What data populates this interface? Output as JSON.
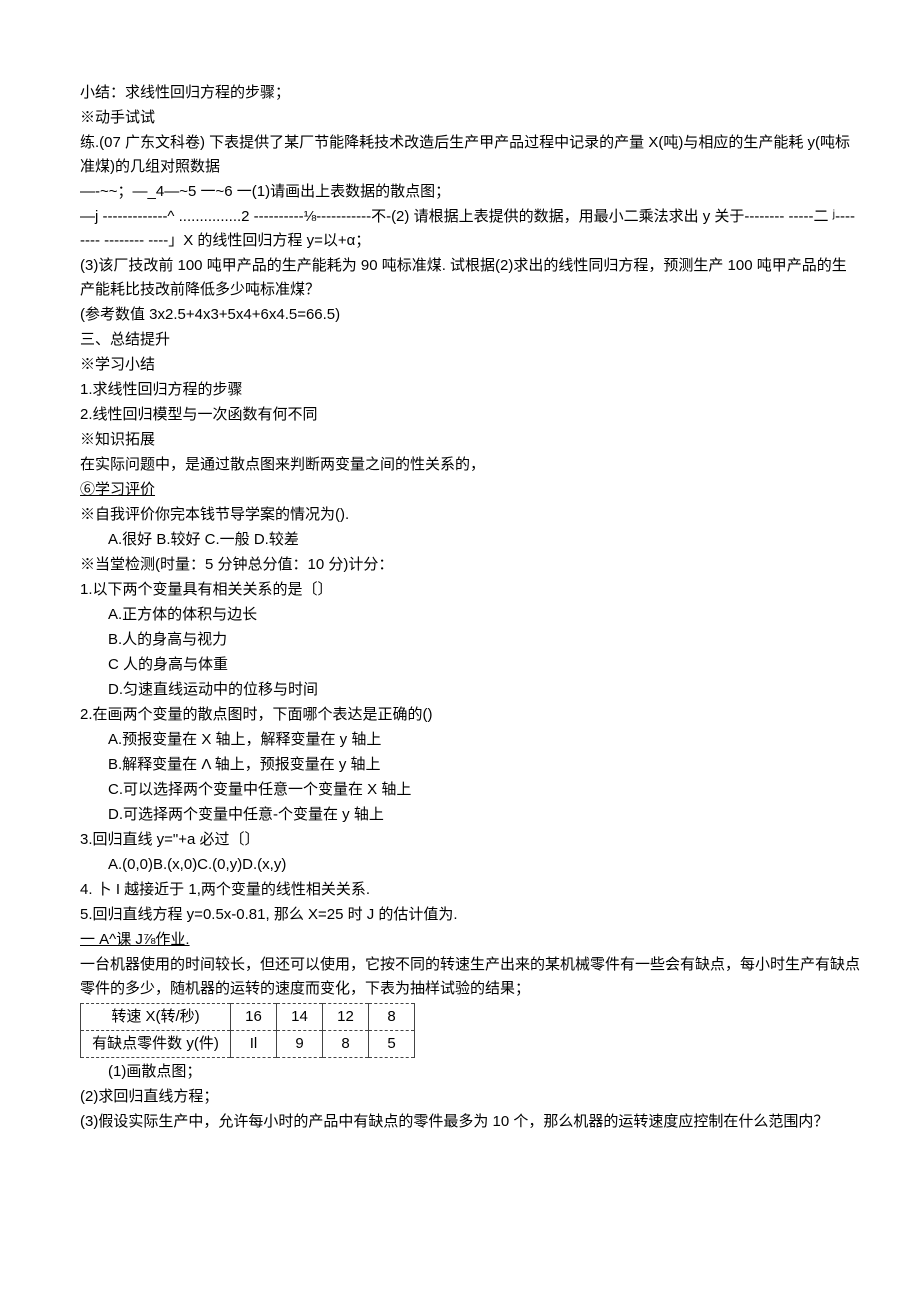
{
  "p1": "小结：求线性回归方程的步骤；",
  "p2": "※动手试试",
  "p3": "练.(07 广东文科卷) 下表提供了某厂节能降耗技术改造后生产甲产品过程中记录的产量 X(吨)与相应的生产能耗 y(吨标准煤)的几组对照数据",
  "p4": "—-~~；—_4—~5 一~6 一(1)请画出上表数据的散点图；",
  "p5": "—j -------------^ ...............2 ----------⅛-----------不-(2) 请根据上表提供的数据，用最小二乘法求出 y 关于-------- -----二 ʲ-------- -------- ----」X 的线性回归方程 y=以+α；",
  "p6": "(3)该厂技改前 100 吨甲产品的生产能耗为 90 吨标准煤. 试根据(2)求出的线性同归方程，预测生产 100 吨甲产品的生产能耗比技改前降低多少吨标准煤？",
  "p7": "(参考数值 3x2.5+4x3+5x4+6x4.5=66.5)",
  "p8": "三、总结提升",
  "p9": "※学习小结",
  "p10": "1.求线性回归方程的步骤",
  "p11": "2.线性回归模型与一次函数有何不同",
  "p12": "※知识拓展",
  "p13": "在实际问题中，是通过散点图来判断两变量之间的性关系的，",
  "p14": "⑥学习评价",
  "p15": "※自我评价你完本钱节导学案的情况为().",
  "p16": "A.很好 B.较好 C.一般 D.较差",
  "p17": "※当堂检测(时量：5 分钟总分值：10 分)计分：",
  "p18": "1.以下两个变量具有相关关系的是〔〕",
  "p19": "A.正方体的体积与边长",
  "p20": "B.人的身高与视力",
  "p21": "C 人的身高与体重",
  "p22": "D.匀速直线运动中的位移与时间",
  "p23": "2.在画两个变量的散点图时，下面哪个表达是正确的()",
  "p24": "A.预报变量在 X 轴上，解释变量在 y 轴上",
  "p25": "B.解释变量在 Λ 轴上，预报变量在 y 轴上",
  "p26": "C.可以选择两个变量中任意一个变量在 X 轴上",
  "p27": "D.可选择两个变量中任意-个变量在 y 轴上",
  "p28": "3.回归直线 y=\"+a 必过〔〕",
  "p29": "A.(0,0)B.(x,0)C.(0,y)D.(x,y)",
  "p30": "4. 卜 I 越接近于 1,两个变量的线性相关关系.",
  "p31": "5.回归直线方程 y=0.5x-0.81, 那么 X=25 时 J 的估计值为.",
  "p32": "一 A^课 J⅞作业.",
  "p33": "一台机器使用的时间较长，但还可以使用，它按不同的转速生产出来的某机械零件有一些会有缺点，每小时生产有缺点零件的多少，随机器的运转的速度而变化，下表为抽样试验的结果；",
  "table": {
    "row1": [
      "转速 X(转/秒)",
      "16",
      "14",
      "12",
      "8"
    ],
    "row2": [
      "有缺点零件数 y(件)",
      "Il",
      "9",
      "8",
      "5"
    ]
  },
  "p34": "(1)画散点图；",
  "p35": "(2)求回归直线方程；",
  "p36": "(3)假设实际生产中，允许每小时的产品中有缺点的零件最多为 10 个，那么机器的运转速度应控制在什么范围内？"
}
